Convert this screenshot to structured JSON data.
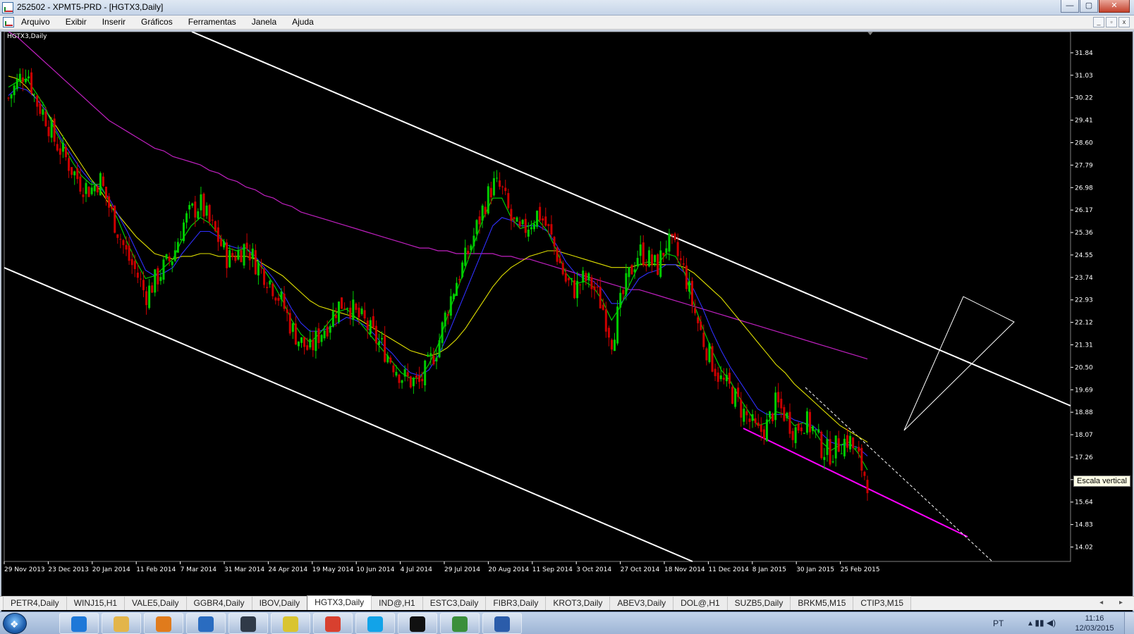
{
  "window": {
    "title": "252502 - XPMT5-PRD - [HGTX3,Daily]",
    "buttons": [
      "—",
      "▢",
      "✕"
    ]
  },
  "menu": {
    "items": [
      "Arquivo",
      "Exibir",
      "Inserir",
      "Gráficos",
      "Ferramentas",
      "Janela",
      "Ajuda"
    ],
    "mdi_buttons": [
      "_",
      "▫",
      "x"
    ]
  },
  "chart": {
    "symbol_label": "HGTX3,Daily",
    "tooltip": "Escala vertical",
    "colors": {
      "background": "#000000",
      "up_candle": "#00cc00",
      "down_candle": "#cc0000",
      "ma_fast": "#00dd00",
      "ma_mid": "#3030ff",
      "ma_slow": "#e0e000",
      "ma_long": "#c020c0",
      "channel": "#ffffff",
      "support": "#ff00ff"
    }
  },
  "chart_data": {
    "type": "candlestick",
    "y_ticks": [
      "31.84",
      "31.03",
      "30.22",
      "29.41",
      "28.60",
      "27.79",
      "26.98",
      "26.17",
      "25.36",
      "24.55",
      "23.74",
      "22.93",
      "22.12",
      "21.31",
      "20.50",
      "19.69",
      "18.88",
      "18.07",
      "17.26",
      "16.45",
      "15.64",
      "14.83",
      "14.02"
    ],
    "y_range": [
      13.5,
      32.6
    ],
    "x_labels": [
      "29 Nov 2013",
      "23 Dec 2013",
      "20 Jan 2014",
      "11 Feb 2014",
      "7 Mar 2014",
      "31 Mar 2014",
      "24 Apr 2014",
      "19 May 2014",
      "10 Jun 2014",
      "4 Jul 2014",
      "29 Jul 2014",
      "20 Aug 2014",
      "11 Sep 2014",
      "3 Oct 2014",
      "27 Oct 2014",
      "18 Nov 2014",
      "11 Dec 2014",
      "8 Jan 2015",
      "30 Jan 2015",
      "25 Feb 2015"
    ],
    "close_path": [
      30.2,
      30.8,
      31.3,
      30.1,
      29.6,
      28.7,
      28.2,
      27.6,
      27.1,
      26.9,
      27.3,
      26.3,
      25.4,
      24.5,
      23.9,
      23.1,
      23.6,
      24.1,
      24.5,
      25.6,
      26.1,
      26.4,
      25.7,
      25.1,
      24.4,
      24.6,
      24.9,
      24.3,
      23.9,
      23.4,
      22.8,
      21.9,
      21.4,
      21.1,
      21.7,
      22.1,
      22.7,
      22.9,
      22.4,
      22.1,
      21.6,
      21.2,
      20.7,
      20.2,
      20.0,
      19.9,
      20.6,
      21.3,
      22.6,
      23.6,
      24.4,
      25.3,
      26.3,
      27.1,
      26.9,
      25.8,
      25.3,
      25.7,
      26.1,
      25.5,
      24.6,
      23.6,
      23.3,
      23.7,
      23.4,
      22.7,
      21.5,
      22.8,
      23.9,
      24.7,
      24.4,
      24.1,
      25.0,
      24.7,
      23.9,
      22.6,
      21.5,
      20.7,
      20.0,
      19.7,
      19.1,
      18.6,
      18.1,
      18.4,
      19.2,
      18.8,
      18.2,
      18.6,
      18.3,
      17.6,
      17.4,
      17.8,
      17.9,
      17.2,
      16.4
    ],
    "ma_fast": [
      30.6,
      30.8,
      30.9,
      30.4,
      29.9,
      29.1,
      28.5,
      27.9,
      27.4,
      27.1,
      27.1,
      26.5,
      25.8,
      25.0,
      24.3,
      23.7,
      23.8,
      24.1,
      24.4,
      25.1,
      25.6,
      25.9,
      25.7,
      25.3,
      24.8,
      24.7,
      24.8,
      24.4,
      24.0,
      23.5,
      22.9,
      22.2,
      21.7,
      21.4,
      21.7,
      22.1,
      22.5,
      22.6,
      22.3,
      21.9,
      21.5,
      21.1,
      20.7,
      20.3,
      20.1,
      20.1,
      20.6,
      21.3,
      22.3,
      23.2,
      24.1,
      25.0,
      25.9,
      26.6,
      26.6,
      25.9,
      25.5,
      25.6,
      25.8,
      25.4,
      24.7,
      23.9,
      23.5,
      23.6,
      23.4,
      22.9,
      22.2,
      22.7,
      23.5,
      24.2,
      24.3,
      24.2,
      24.6,
      24.5,
      23.9,
      22.8,
      21.9,
      21.1,
      20.4,
      20.0,
      19.4,
      18.9,
      18.4,
      18.5,
      18.9,
      18.8,
      18.4,
      18.5,
      18.3,
      17.8,
      17.5,
      17.7,
      17.8,
      17.4,
      16.8
    ],
    "ma_mid": [
      30.3,
      30.6,
      30.5,
      30.2,
      29.8,
      29.2,
      28.6,
      28.1,
      27.6,
      27.2,
      27.0,
      26.6,
      26.0,
      25.4,
      24.7,
      24.0,
      23.8,
      23.9,
      24.1,
      24.6,
      25.0,
      25.4,
      25.4,
      25.2,
      24.9,
      24.8,
      24.8,
      24.5,
      24.1,
      23.7,
      23.2,
      22.6,
      22.1,
      21.8,
      21.8,
      21.9,
      22.1,
      22.3,
      22.2,
      22.0,
      21.7,
      21.3,
      21.0,
      20.6,
      20.3,
      20.2,
      20.4,
      20.9,
      21.6,
      22.4,
      23.2,
      24.0,
      24.8,
      25.6,
      25.9,
      25.8,
      25.6,
      25.6,
      25.6,
      25.4,
      24.9,
      24.3,
      23.9,
      23.7,
      23.6,
      23.3,
      22.8,
      22.8,
      23.2,
      23.7,
      23.9,
      24.0,
      24.2,
      24.2,
      23.9,
      23.3,
      22.6,
      21.8,
      21.1,
      20.5,
      20.0,
      19.5,
      19.0,
      18.8,
      18.8,
      18.8,
      18.6,
      18.5,
      18.4,
      18.1,
      17.8,
      17.7,
      17.7,
      17.6,
      17.3
    ],
    "ma_slow": [
      31.0,
      30.9,
      30.6,
      30.2,
      29.8,
      29.3,
      28.8,
      28.3,
      27.8,
      27.3,
      26.9,
      26.4,
      26.0,
      25.6,
      25.2,
      24.9,
      24.6,
      24.5,
      24.4,
      24.5,
      24.5,
      24.6,
      24.6,
      24.5,
      24.5,
      24.5,
      24.5,
      24.4,
      24.2,
      24.0,
      23.8,
      23.5,
      23.2,
      22.9,
      22.7,
      22.6,
      22.5,
      22.4,
      22.3,
      22.1,
      21.9,
      21.7,
      21.5,
      21.3,
      21.1,
      21.0,
      20.9,
      21.0,
      21.2,
      21.5,
      21.9,
      22.4,
      22.9,
      23.4,
      23.8,
      24.1,
      24.3,
      24.5,
      24.6,
      24.7,
      24.7,
      24.6,
      24.5,
      24.4,
      24.3,
      24.2,
      24.1,
      24.1,
      24.1,
      24.2,
      24.2,
      24.2,
      24.2,
      24.2,
      24.1,
      23.9,
      23.6,
      23.3,
      23.0,
      22.6,
      22.2,
      21.8,
      21.4,
      21.0,
      20.6,
      20.3,
      19.9,
      19.6,
      19.3,
      19.0,
      18.7,
      18.4,
      18.2,
      18.0,
      17.8
    ],
    "ma_long": [
      32.6,
      32.4,
      32.1,
      31.8,
      31.5,
      31.2,
      30.9,
      30.6,
      30.3,
      30.0,
      29.7,
      29.4,
      29.2,
      29.0,
      28.8,
      28.6,
      28.4,
      28.3,
      28.1,
      28.0,
      27.9,
      27.8,
      27.6,
      27.5,
      27.3,
      27.2,
      27.0,
      26.9,
      26.7,
      26.6,
      26.4,
      26.3,
      26.1,
      26.0,
      25.9,
      25.8,
      25.7,
      25.6,
      25.5,
      25.4,
      25.3,
      25.2,
      25.1,
      25.0,
      24.9,
      24.8,
      24.8,
      24.7,
      24.7,
      24.6,
      24.6,
      24.6,
      24.6,
      24.6,
      24.5,
      24.5,
      24.4,
      24.4,
      24.3,
      24.2,
      24.1,
      24.0,
      23.9,
      23.8,
      23.7,
      23.6,
      23.5,
      23.4,
      23.3,
      23.3,
      23.2,
      23.1,
      23.0,
      22.9,
      22.8,
      22.7,
      22.6,
      22.5,
      22.4,
      22.3,
      22.2,
      22.1,
      22.0,
      21.9,
      21.8,
      21.7,
      21.6,
      21.5,
      21.4,
      21.3,
      21.2,
      21.1,
      21.0,
      20.9,
      20.8
    ]
  },
  "tabs": {
    "items": [
      "PETR4,Daily",
      "WINJ15,H1",
      "VALE5,Daily",
      "GGBR4,Daily",
      "IBOV,Daily",
      "HGTX3,Daily",
      "IND@,H1",
      "ESTC3,Daily",
      "FIBR3,Daily",
      "KROT3,Daily",
      "ABEV3,Daily",
      "DOL@,H1",
      "SUZB5,Daily",
      "BRKM5,M15",
      "CTIP3,M15"
    ],
    "active_index": 5,
    "scroll_arrows": "◂ ▸"
  },
  "taskbar": {
    "icons": [
      {
        "name": "ie-icon",
        "color": "#1e78d8"
      },
      {
        "name": "folder-icon",
        "color": "#e3b54a"
      },
      {
        "name": "media-player-icon",
        "color": "#e07b1c"
      },
      {
        "name": "arrow-app-icon",
        "color": "#2a6cc0"
      },
      {
        "name": "hp-icon",
        "color": "#303a48"
      },
      {
        "name": "cash-app-icon",
        "color": "#d9c430"
      },
      {
        "name": "chrome-icon",
        "color": "#d8402f"
      },
      {
        "name": "skype-icon",
        "color": "#12a3e8"
      },
      {
        "name": "xp-icon",
        "color": "#111111"
      },
      {
        "name": "metatrader-icon",
        "color": "#3b8f3b"
      },
      {
        "name": "word-icon",
        "color": "#2b5caa"
      }
    ],
    "language": "PT",
    "time": "11:16",
    "date": "12/03/2015"
  }
}
